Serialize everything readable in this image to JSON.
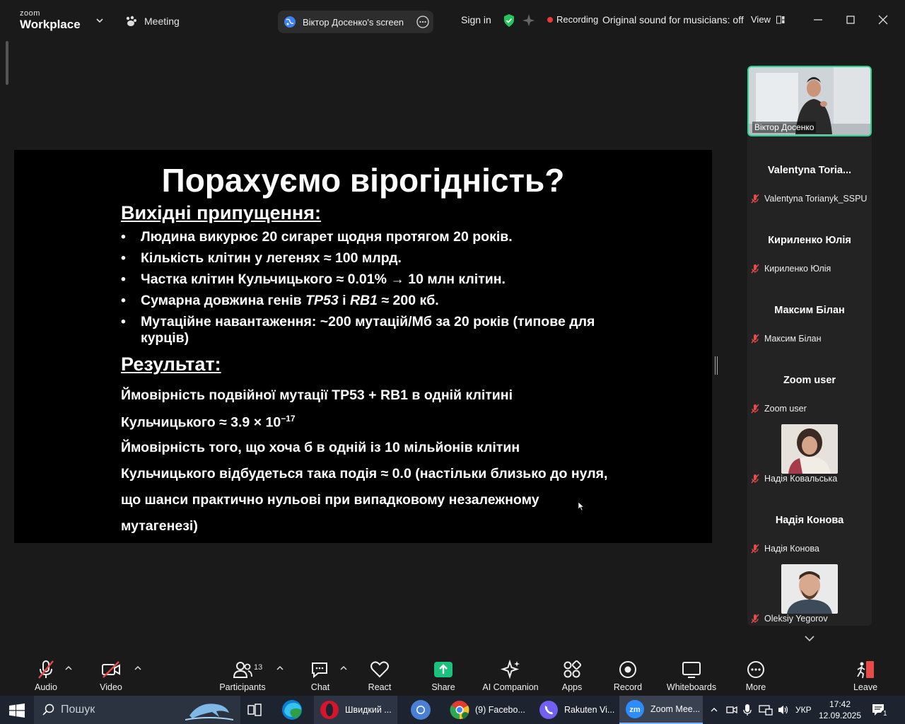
{
  "top_bar": {
    "logo_line1": "zoom",
    "logo_line2": "Workplace",
    "meeting_label": "Meeting",
    "screen_share_label": "Віктор Досенко's screen",
    "sign_in": "Sign in",
    "recording_label": "Recording",
    "original_sound": "Original sound for musicians: off",
    "view_label": "View",
    "colors": {
      "recording_dot": "#e83a3a",
      "shield": "#22c55e"
    }
  },
  "slide": {
    "title": "Порахуємо вірогідність?",
    "assumptions_heading": "Вихідні припущення:",
    "bullets": [
      {
        "pre": "Людина викурює 20 сигарет щодня протягом 20 років."
      },
      {
        "pre": "Кількість клітин у легенях ≈ 100 млрд."
      },
      {
        "pre": "Частка клітин Кульчицького ≈  0.01% → 10 млн клітин."
      },
      {
        "pre": "Сумарна довжина генів ",
        "gene1": "TP53",
        "mid": " і ",
        "gene2": "RB1",
        "post": " ≈ 200 кб."
      },
      {
        "pre": "Мутаційне навантаження: ~200 мутацій/Мб за 20 років (типове для курців)"
      }
    ],
    "result_heading": "Результат:",
    "result_lines": [
      "Ймовірність подвійної мутації TP53 + RB1 в одній клітині",
      "Кульчицького ≈ 3.9 × 10",
      "Ймовірність того, що хоча б в одній із 10 мільйонів клітин",
      "Кульчицького відбудеться така подія ≈ 0.0 (настільки близько до нуля,",
      "що шанси практично нульові при випадковому незалежному",
      "мутагенезі)"
    ],
    "exponent": "−17"
  },
  "participants_panel": {
    "active_speaker": "Віктор Досенко",
    "participants": [
      {
        "display": "Valentyna  Toria...",
        "name": "Valentyna Torianyk_SSPU"
      },
      {
        "display": "Кириленко Юлія",
        "name": "Кириленко Юлія"
      },
      {
        "display": "Максим Білан",
        "name": "Максим Білан"
      },
      {
        "display": "Zoom user",
        "name": "Zoom user"
      },
      {
        "name": "Надія Ковальська"
      },
      {
        "display": "Надія Конова",
        "name": "Надія Конова"
      },
      {
        "name": "Oleksiy Yegorov"
      }
    ],
    "colors": {
      "active_border": "#22d48e",
      "muted_mic": "#e84a4a"
    }
  },
  "toolbar": {
    "audio": "Audio",
    "video": "Video",
    "participants": "Participants",
    "participants_count": "13",
    "chat": "Chat",
    "react": "React",
    "share": "Share",
    "ai_companion": "AI Companion",
    "apps": "Apps",
    "record": "Record",
    "whiteboards": "Whiteboards",
    "more": "More",
    "leave": "Leave",
    "colors": {
      "share": "#19c37d",
      "leave": "#e84a4a"
    }
  },
  "taskbar": {
    "search_placeholder": "Пошук",
    "apps": [
      {
        "label": "Швидкий ..."
      },
      {
        "label": "(9) Facebo..."
      },
      {
        "label": "Rakuten Vi..."
      },
      {
        "label": "Zoom Mee..."
      }
    ],
    "language": "УКР",
    "time": "17:42",
    "date": "12.09.2025",
    "notification_count": "1"
  }
}
